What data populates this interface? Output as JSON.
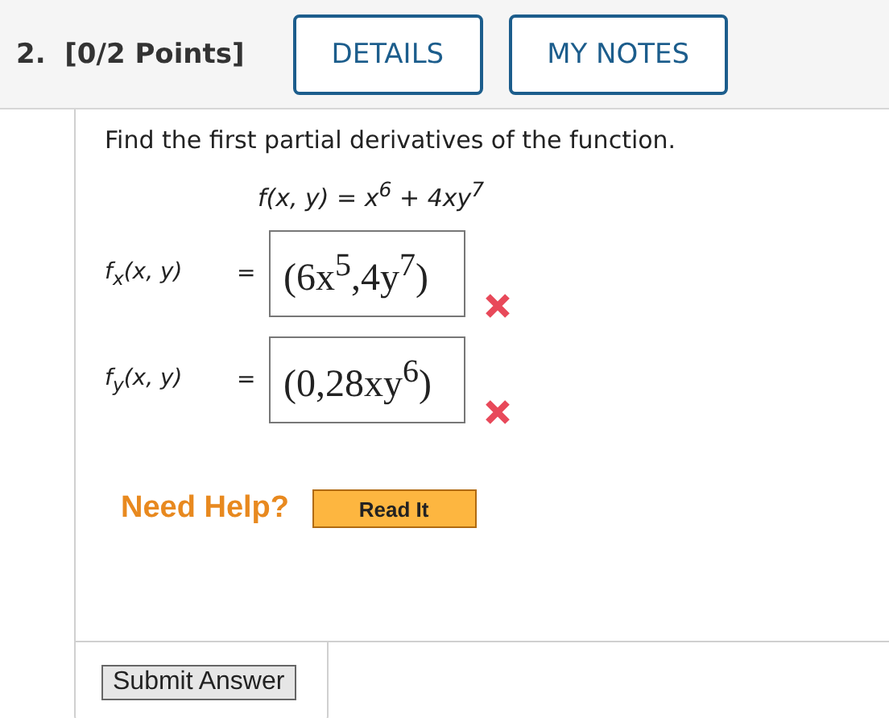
{
  "question": {
    "number": "2.",
    "points": "[0/2 Points]"
  },
  "header_buttons": [
    "DETAILS",
    "MY NOTES"
  ],
  "prompt": "Find the first partial derivatives of the function.",
  "function": "f(x, y) = x$^{6}$ + 4xy$^{7}$",
  "answers": [
    {
      "label": "f$_{x}$(x, y)",
      "equals": "=",
      "value": "(6x$^{5}$,4y$^{7}$)",
      "correct": false
    },
    {
      "label": "f$_{y}$(x, y)",
      "equals": "=",
      "value": "(0,28xy$^{6}$)",
      "correct": false
    }
  ],
  "help": {
    "label": "Need Help?",
    "button": "Read It"
  },
  "submit": "Submit Answer"
}
